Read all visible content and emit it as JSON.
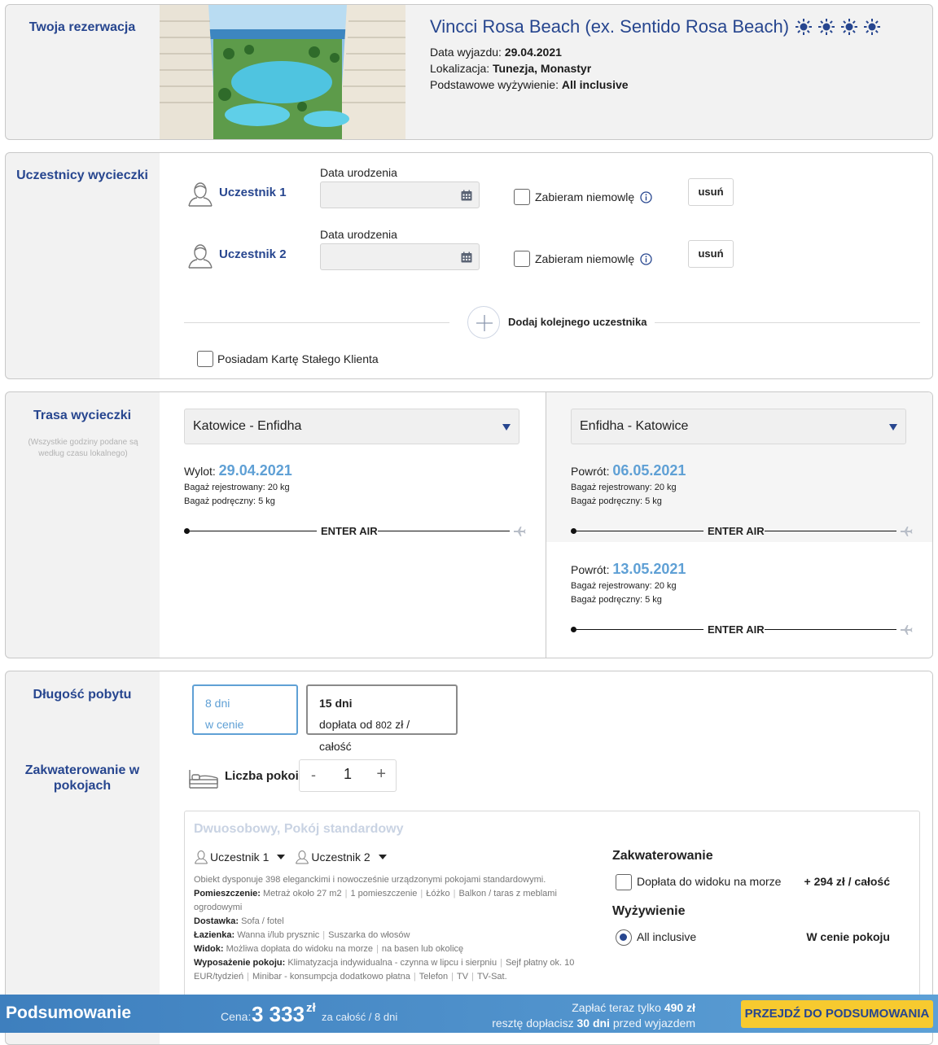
{
  "reservation": {
    "side_title": "Twoja rezerwacja",
    "hotel_name": "Vincci Rosa Beach (ex. Sentido Rosa Beach)",
    "stars": 4,
    "departure_label": "Data wyjazdu:",
    "departure_value": "29.04.2021",
    "location_label": "Lokalizacja:",
    "location_value": "Tunezja, Monastyr",
    "board_label": "Podstawowe wyżywienie:",
    "board_value": "All inclusive"
  },
  "participants": {
    "side_title": "Uczestnicy wycieczki",
    "rows": [
      {
        "name": "Uczestnik 1",
        "dob_label": "Data urodzenia",
        "dob_value": "",
        "infant_label": "Zabieram niemowlę",
        "remove_label": "usuń"
      },
      {
        "name": "Uczestnik 2",
        "dob_label": "Data urodzenia",
        "dob_value": "",
        "infant_label": "Zabieram niemowlę",
        "remove_label": "usuń"
      }
    ],
    "add_label": "Dodaj kolejnego uczestnika",
    "loyalty_label": "Posiadam Kartę Stałego Klienta"
  },
  "route": {
    "side_title": "Trasa wycieczki",
    "side_note": "(Wszystkie godziny podane są według czasu lokalnego)",
    "outbound": {
      "select_value": "Katowice - Enfidha",
      "flight": {
        "label": "Wylot:",
        "date": "29.04.2021",
        "baggage_checked": "Bagaż rejestrowany: 20 kg",
        "baggage_hand": "Bagaż podręczny: 5 kg",
        "airline": "ENTER AIR"
      }
    },
    "return": {
      "select_value": "Enfidha - Katowice",
      "flights": [
        {
          "label": "Powrót:",
          "date": "06.05.2021",
          "baggage_checked": "Bagaż rejestrowany: 20 kg",
          "baggage_hand": "Bagaż podręczny: 5 kg",
          "airline": "ENTER AIR"
        },
        {
          "label": "Powrót:",
          "date": "13.05.2021",
          "baggage_checked": "Bagaż rejestrowany: 20 kg",
          "baggage_hand": "Bagaż podręczny: 5 kg",
          "airline": "ENTER AIR"
        }
      ]
    }
  },
  "stay": {
    "side_title": "Długość pobytu",
    "options": [
      {
        "days": "8 dni",
        "note": "w cenie",
        "selected": true
      },
      {
        "days": "15 dni",
        "note_prefix": "dopłata od",
        "amount": "802",
        "note_suffix": "zł / całość",
        "selected": false
      }
    ]
  },
  "accommodation": {
    "side_title": "Zakwaterowanie w pokojach",
    "rooms_label": "Liczba pokoi",
    "rooms_value": "1",
    "minus": "-",
    "plus": "+",
    "room": {
      "title": "Dwuosobowy, Pokój standardowy",
      "persons": [
        "Uczestnik 1",
        "Uczestnik 2"
      ],
      "intro": "Obiekt dysponuje 398 eleganckimi i nowocześnie urządzonymi pokojami standardowymi.",
      "rows": [
        {
          "label": "Pomieszczenie:",
          "items": [
            "Metraż około 27 m2",
            "1 pomieszczenie",
            "Łóżko",
            "Balkon / taras z meblami ogrodowymi"
          ]
        },
        {
          "label": "Dostawka:",
          "items": [
            "Sofa / fotel"
          ]
        },
        {
          "label": "Łazienka:",
          "items": [
            "Wanna i/lub prysznic",
            "Suszarka do włosów"
          ]
        },
        {
          "label": "Widok:",
          "items": [
            "Możliwa dopłata do widoku na morze",
            "na basen lub okolicę"
          ]
        },
        {
          "label": "Wyposażenie pokoju:",
          "items": [
            "Klimatyzacja indywidualna - czynna w lipcu i sierpniu",
            "Sejf płatny ok. 10 EUR/tydzień",
            "Minibar - konsumpcja dodatkowo płatna",
            "Telefon",
            "TV",
            "TV-Sat."
          ]
        }
      ],
      "accommodation_head": "Zakwaterowanie",
      "sea_view_label": "Dopłata do widoku na morze",
      "sea_view_price": "+ 294 zł / całość",
      "board_head": "Wyżywienie",
      "board_option": "All inclusive",
      "board_price": "W cenie pokoju"
    }
  },
  "summary": {
    "title": "Podsumowanie",
    "price_label": "Cena:",
    "price": "3 333",
    "currency": "zł",
    "price_note": "za całość / 8 dni",
    "pay_now_prefix": "Zapłać teraz tylko",
    "pay_now_amount": "490 zł",
    "rest_prefix": "resztę dopłacisz",
    "rest_days": "30 dni",
    "rest_suffix": "przed wyjazdem",
    "cta": "PRZEJDŹ DO PODSUMOWANIA"
  },
  "colors": {
    "brand_blue": "#27468f",
    "accent_blue": "#5fa0d5",
    "cta_yellow": "#f7ca2f"
  }
}
